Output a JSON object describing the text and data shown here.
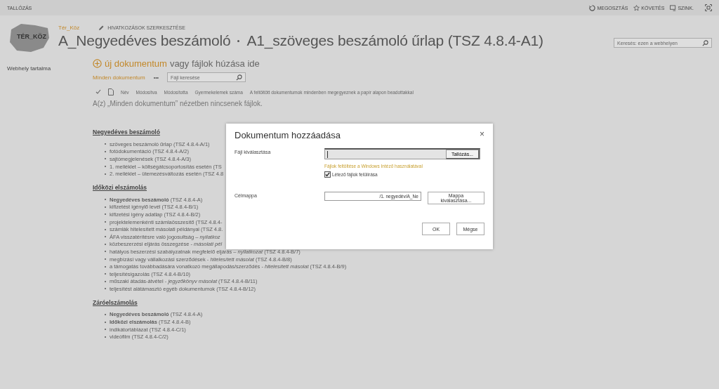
{
  "suite_bar": {
    "title": "TALLÓZÁS",
    "actions": [
      {
        "kind": "share",
        "label": "MEGOSZTÁS"
      },
      {
        "kind": "follow",
        "label": "KÖVETÉS"
      },
      {
        "kind": "sync",
        "label": "SZINK."
      }
    ]
  },
  "header": {
    "logo_text": "TÉR_KÖZ",
    "site_link": "Tér_Köz",
    "edit_links": "HIVATKOZÁSOK SZERKESZTÉSE",
    "breadcrumb": [
      "A_Negyedéves beszámoló",
      "A1_szöveges beszámoló űrlap (TSZ 4.8.4-A1)"
    ],
    "search": {
      "placeholder": "Keresés: ezen a webhelyen"
    }
  },
  "sidebar": {
    "items": [
      "Webhely tartalma"
    ]
  },
  "new_document": {
    "link": "új dokumentum",
    "text": "vagy fájlok húzása ide"
  },
  "views": {
    "current": "Minden dokumentum",
    "more": "•••",
    "search": {
      "placeholder": "Fájl keresése"
    }
  },
  "columns": [
    "Név",
    "Módosítva",
    "Módosította",
    "Gyermekelemek száma",
    "A feltöltött dokumentumok mindenben megegyeznek a papír alapon beadottakkal"
  ],
  "empty_message": "A(z) „Minden dokumentum” nézetben nincsenek fájlok.",
  "sections": [
    {
      "heading": "Negyedéves beszámoló",
      "items": [
        "szöveges beszámoló űrlap (TSZ 4.8.4-A/1)",
        "fotódokumentáció (TSZ 4.8.4-A/2)",
        "sajtómegjelenések (TSZ 4.8.4-A/3)",
        "1. melléklet – költségátcsoportosítás esetén (TS",
        "2. melléklet – ütemezésváltozás esetén (TSZ 4.8"
      ]
    },
    {
      "heading": "Időközi elszámolás",
      "items": [
        "**Negyedéves beszámoló** (TSZ 4.8.4-A)",
        "kifizetést igénylő levél (TSZ 4.8.4-B/1)",
        "kifizetési igény adatlap (TSZ 4.8.4-B/2)",
        "projektelemenkénti számlaösszesítő (TSZ 4.8.4-",
        "számlák hitelesített másolati példányai (TSZ 4.8.",
        "ÁFA visszatérítésre való jogosultság – *nyilatkoz*",
        "közbeszerzési eljárás összegzése - *másolati pél*",
        "hatályos beszerzési szabályzatnak megfelelő eljárás – *nyilatkozat* (TSZ 4.8.4-B/7)",
        "megbízási vagy vállalkozási szerződések - *hitelesített másolat* (TSZ 4.8.4-B/8)",
        "a támogatás továbbadására vonatkozó megállapodás/szerződés - *hitelesített másolat* (TSZ 4.8.4-B/9)",
        "teljesítésigazolás (TSZ 4.8.4-B/10)",
        "műszaki átadás-átvétel - *jegyzőkönyv másolat* (TSZ 4.8.4-B/11)",
        "teljesítést alátámasztó egyéb dokumentumok (TSZ 4.8.4-B/12)"
      ]
    },
    {
      "heading": "Záróelszámolás",
      "items": [
        "**Negyedéves beszámoló** (TSZ 4.8.4-A)",
        "**Időközi elszámolás** (TSZ 4.8.4-B)",
        "indikátortáblázat (TSZ 4.8.4-C/1)",
        "videófilm (TSZ 4.8.4-C/2)"
      ]
    }
  ],
  "dialog": {
    "title": "Dokumentum hozzáadása",
    "close": "×",
    "file_label": "Fájl kiválasztása",
    "browse_button": "Tallózás...",
    "explorer_link": "Fájlok feltöltése a Windows Intéző használatával",
    "overwrite": {
      "label": "Létező fájlok felülírása",
      "checked": true
    },
    "folder_label": "Célmappa",
    "folder_value": "/1. negyedév/A_Ne",
    "folder_button": "Mappa kiválasztása...",
    "buttons": [
      "OK",
      "Mégse"
    ]
  }
}
